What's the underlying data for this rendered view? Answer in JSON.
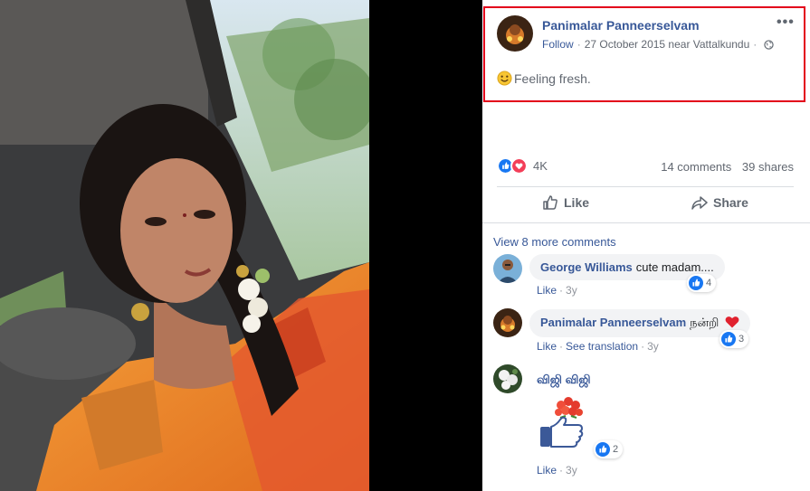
{
  "post": {
    "author": "Panimalar Panneerselvam",
    "follow_label": "Follow",
    "date": "27 October 2015 near Vattalkundu",
    "status": "Feeling fresh.",
    "more_icon": "more-options-icon",
    "privacy_icon": "globe-icon"
  },
  "stats": {
    "reaction_count": "4K",
    "comments": "14 comments",
    "shares": "39 shares",
    "reaction_icons": [
      "like-reaction-icon",
      "love-reaction-icon"
    ]
  },
  "actions": {
    "like": "Like",
    "share": "Share"
  },
  "comments_section": {
    "view_more": "View 8 more comments",
    "comments": [
      {
        "author": "George Williams",
        "text": "cute madam....",
        "like": "Like",
        "age": "3y",
        "reactions": "4"
      },
      {
        "author": "Panimalar Panneerselvam",
        "text": "நன்றி",
        "like": "Like",
        "translation": "See translation",
        "age": "3y",
        "reactions": "3"
      },
      {
        "author": "விஜி விஜி",
        "like": "Like",
        "age": "3y",
        "reactions": "2",
        "sticker": "flowers-thumbs-up-sticker"
      }
    ]
  },
  "colors": {
    "link": "#385898",
    "highlight": "#e3001b",
    "like_blue": "#1877f2",
    "love_red": "#f33e58"
  }
}
